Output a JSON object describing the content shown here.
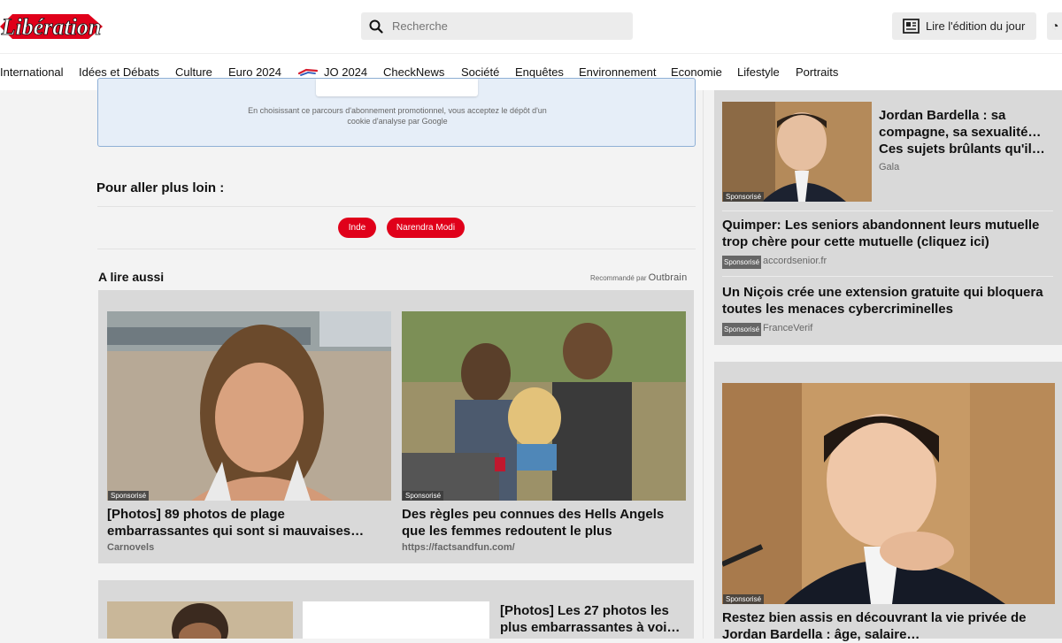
{
  "header": {
    "logo_text": "Libération",
    "search_placeholder": "Recherche",
    "read_edition": "Lire l'édition du jour"
  },
  "nav": {
    "items": [
      "International",
      "Idées et Débats",
      "Culture",
      "Euro 2024",
      "JO 2024",
      "CheckNews",
      "Société",
      "Enquêtes",
      "Environnement",
      "Economie",
      "Lifestyle",
      "Portraits"
    ]
  },
  "promo": {
    "text_line1": "En choisissant ce parcours d'abonnement promotionnel, vous acceptez le dépôt d'un",
    "text_line2": "cookie d'analyse par Google"
  },
  "further": {
    "title": "Pour aller plus loin :",
    "tags": [
      "Inde",
      "Narendra Modi"
    ]
  },
  "also": {
    "title": "A lire aussi",
    "recommended": "Recommandé par",
    "brand": "Outbrain",
    "sponsored_label": "Sponsorisé",
    "cards": [
      {
        "title_line1": "[Photos] 89 photos de plage",
        "title_line2": "embarrassantes qui sont si mauvaises…",
        "source": "Carnovels"
      },
      {
        "title_line1": "Des règles peu connues des Hells Angels",
        "title_line2": "que les femmes redoutent le plus",
        "source": "https://factsandfun.com/"
      },
      {
        "title_line1": "[Photos] Les 27 photos les",
        "title_line2": "plus embarrassantes à voi…",
        "source": ""
      }
    ]
  },
  "right": {
    "sponsored_label": "Sponsorisé",
    "items": [
      {
        "title_line1": "Jordan Bardella : sa",
        "title_line2": "compagne, sa sexualité…",
        "title_line3": "Ces sujets brûlants qu'il…",
        "source": "Gala"
      },
      {
        "title_line1": "Quimper: Les seniors abandonnent leurs mutuelle",
        "title_line2": "trop chère pour cette mutuelle (cliquez ici)",
        "source": "accordsenior.fr"
      },
      {
        "title_line1": "Un Niçois crée une extension gratuite qui bloquera",
        "title_line2": "toutes les menaces cybercriminelles",
        "source": "FranceVerif"
      },
      {
        "title_line1": "Restez bien assis en découvrant la vie privée de",
        "title_line2": "Jordan Bardella : âge, salaire…",
        "source": ""
      }
    ]
  },
  "colors": {
    "brand_red": "#e0001a",
    "promo_bg": "#e6eef8",
    "card_bg": "#d9d9d9"
  }
}
